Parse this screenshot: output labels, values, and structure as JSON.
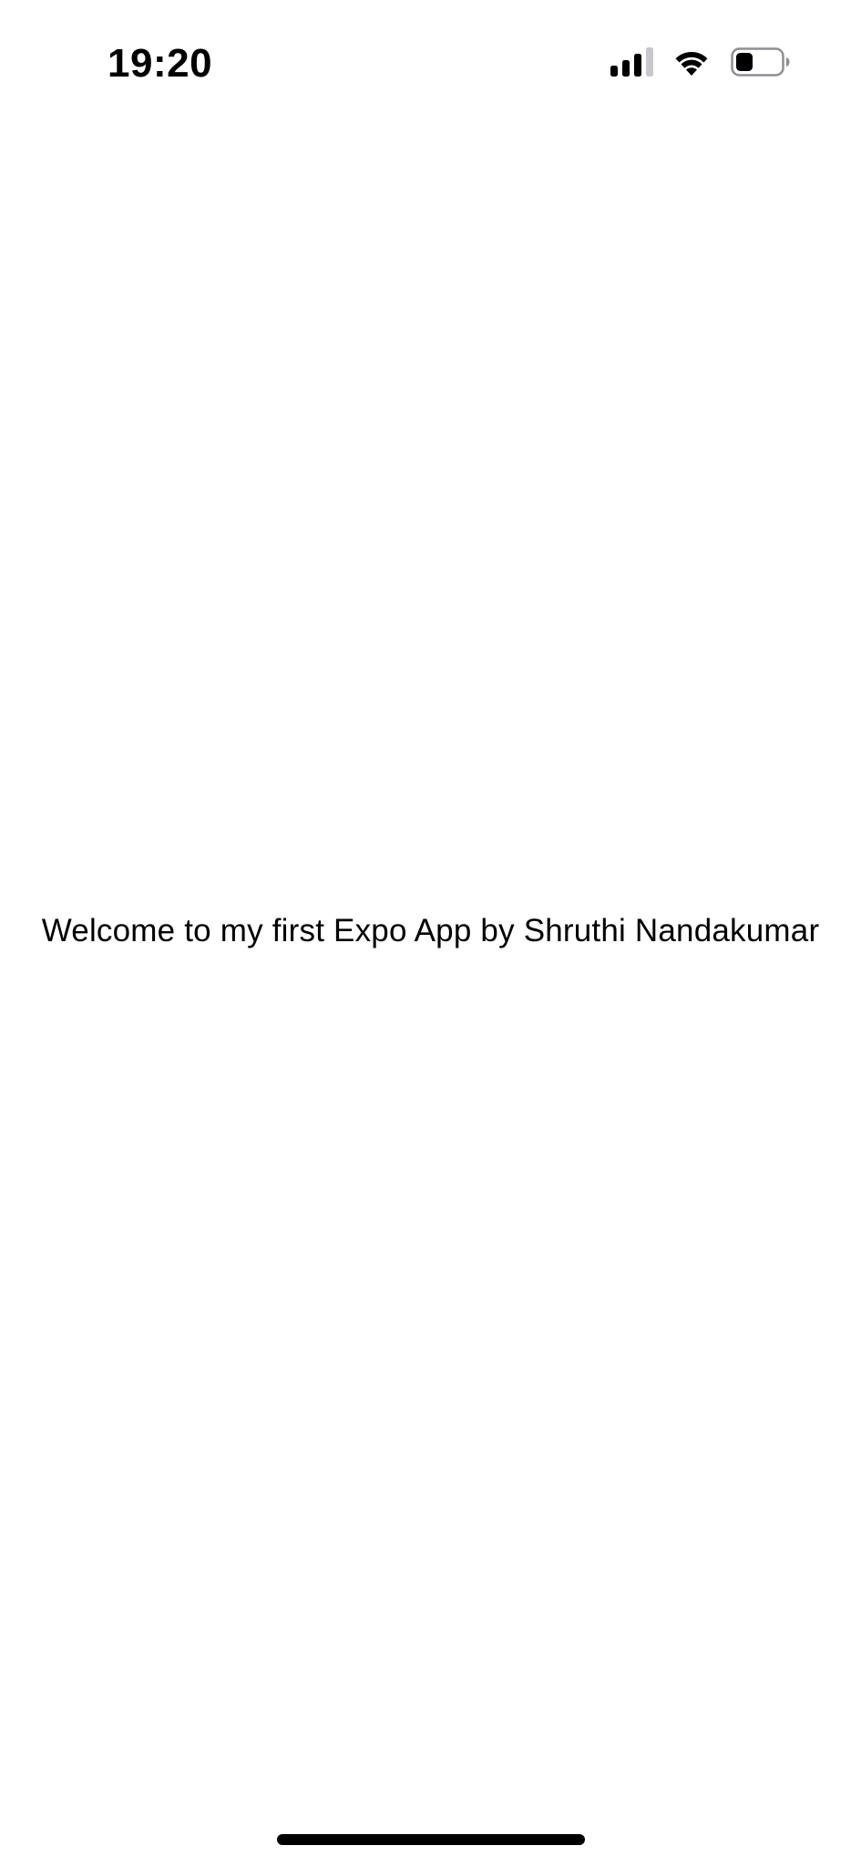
{
  "status_bar": {
    "time": "19:20",
    "icons": [
      "cellular-signal-icon",
      "wifi-icon",
      "battery-icon"
    ],
    "battery_level_fraction": 0.3
  },
  "main": {
    "welcome_text": "Welcome to my first Expo App by Shruthi Nandakumar"
  },
  "colors": {
    "background": "#ffffff",
    "text": "#000000",
    "signal_inactive": "#c7c7cc"
  }
}
